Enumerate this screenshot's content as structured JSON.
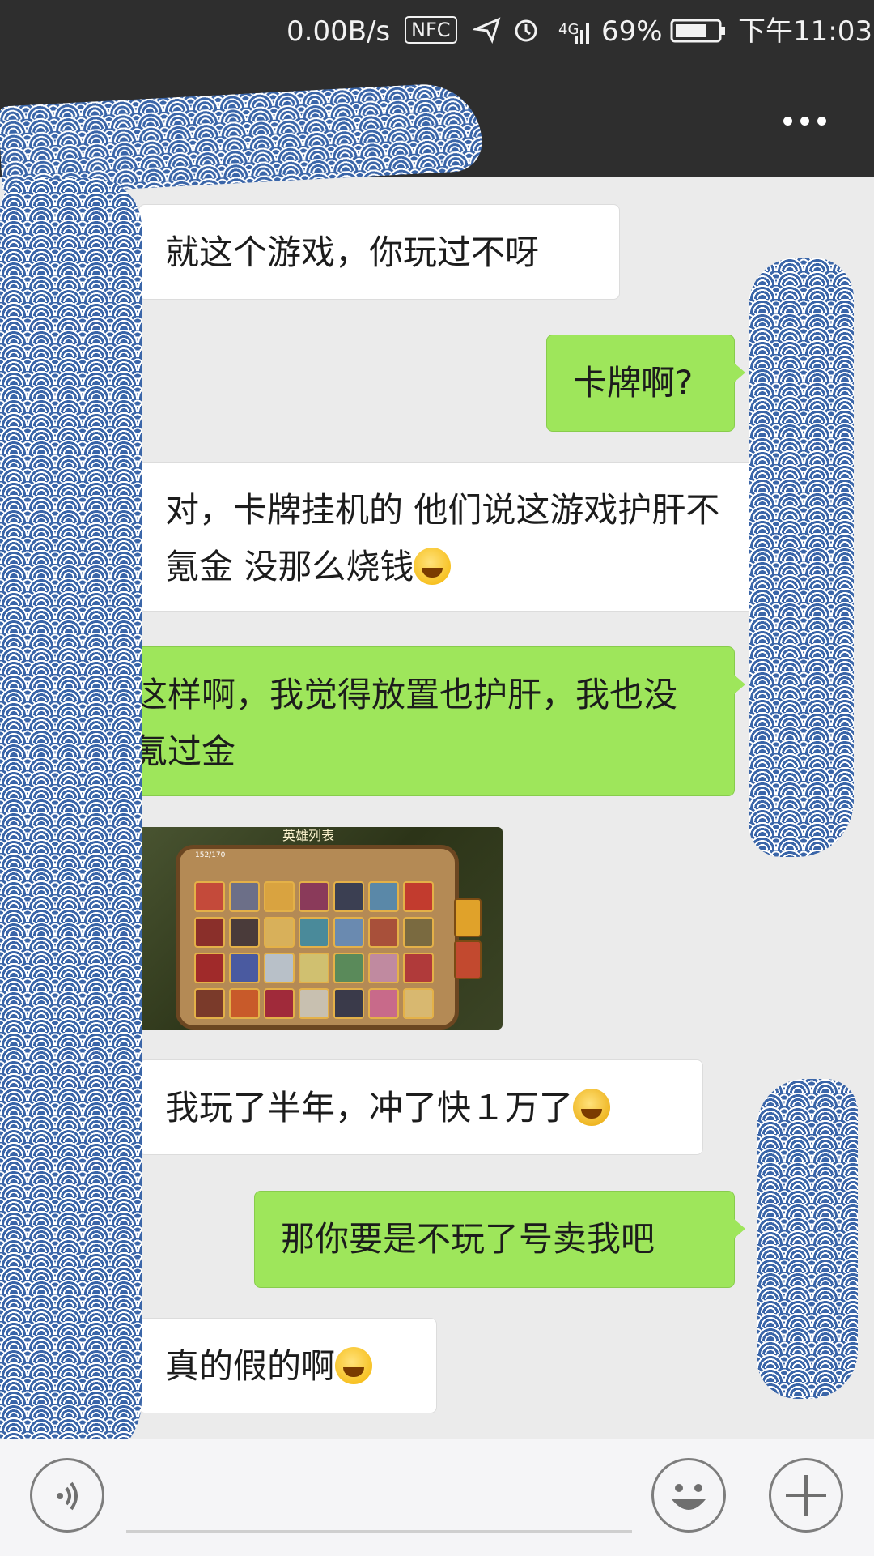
{
  "status_bar": {
    "network_speed": "0.00B/s",
    "nfc": "NFC",
    "signal": "4G",
    "battery": "69%",
    "time": "下午11:03"
  },
  "header": {
    "back_icon": "back-arrow-icon",
    "menu_icon": "more-dots-icon"
  },
  "messages": [
    {
      "side": "in",
      "text": "就这个游戏，你玩过不呀"
    },
    {
      "side": "out",
      "text": "卡牌啊?"
    },
    {
      "side": "in",
      "text": "对，卡牌挂机的  他们说这游戏护肝不氪金 没那么烧钱"
    },
    {
      "side": "out",
      "text": "这样啊，我觉得放置也护肝，我也没氪过金"
    },
    {
      "side": "in",
      "type": "image",
      "caption_title": "英雄列表",
      "counter": "152/170"
    },
    {
      "side": "in",
      "text": "我玩了半年，冲了快１万了"
    },
    {
      "side": "out",
      "text": "那你要是不玩了号卖我吧"
    },
    {
      "side": "in",
      "text": "真的假的啊"
    }
  ],
  "input_bar": {
    "voice_icon": "voice-icon",
    "emoji_icon": "emoji-icon",
    "add_icon": "plus-icon"
  },
  "colors": {
    "header_bg": "#2e2e2e",
    "chat_bg": "#ebebeb",
    "outgoing_bubble": "#9ee65b",
    "incoming_bubble": "#ffffff",
    "redaction": "#3a65a8"
  }
}
